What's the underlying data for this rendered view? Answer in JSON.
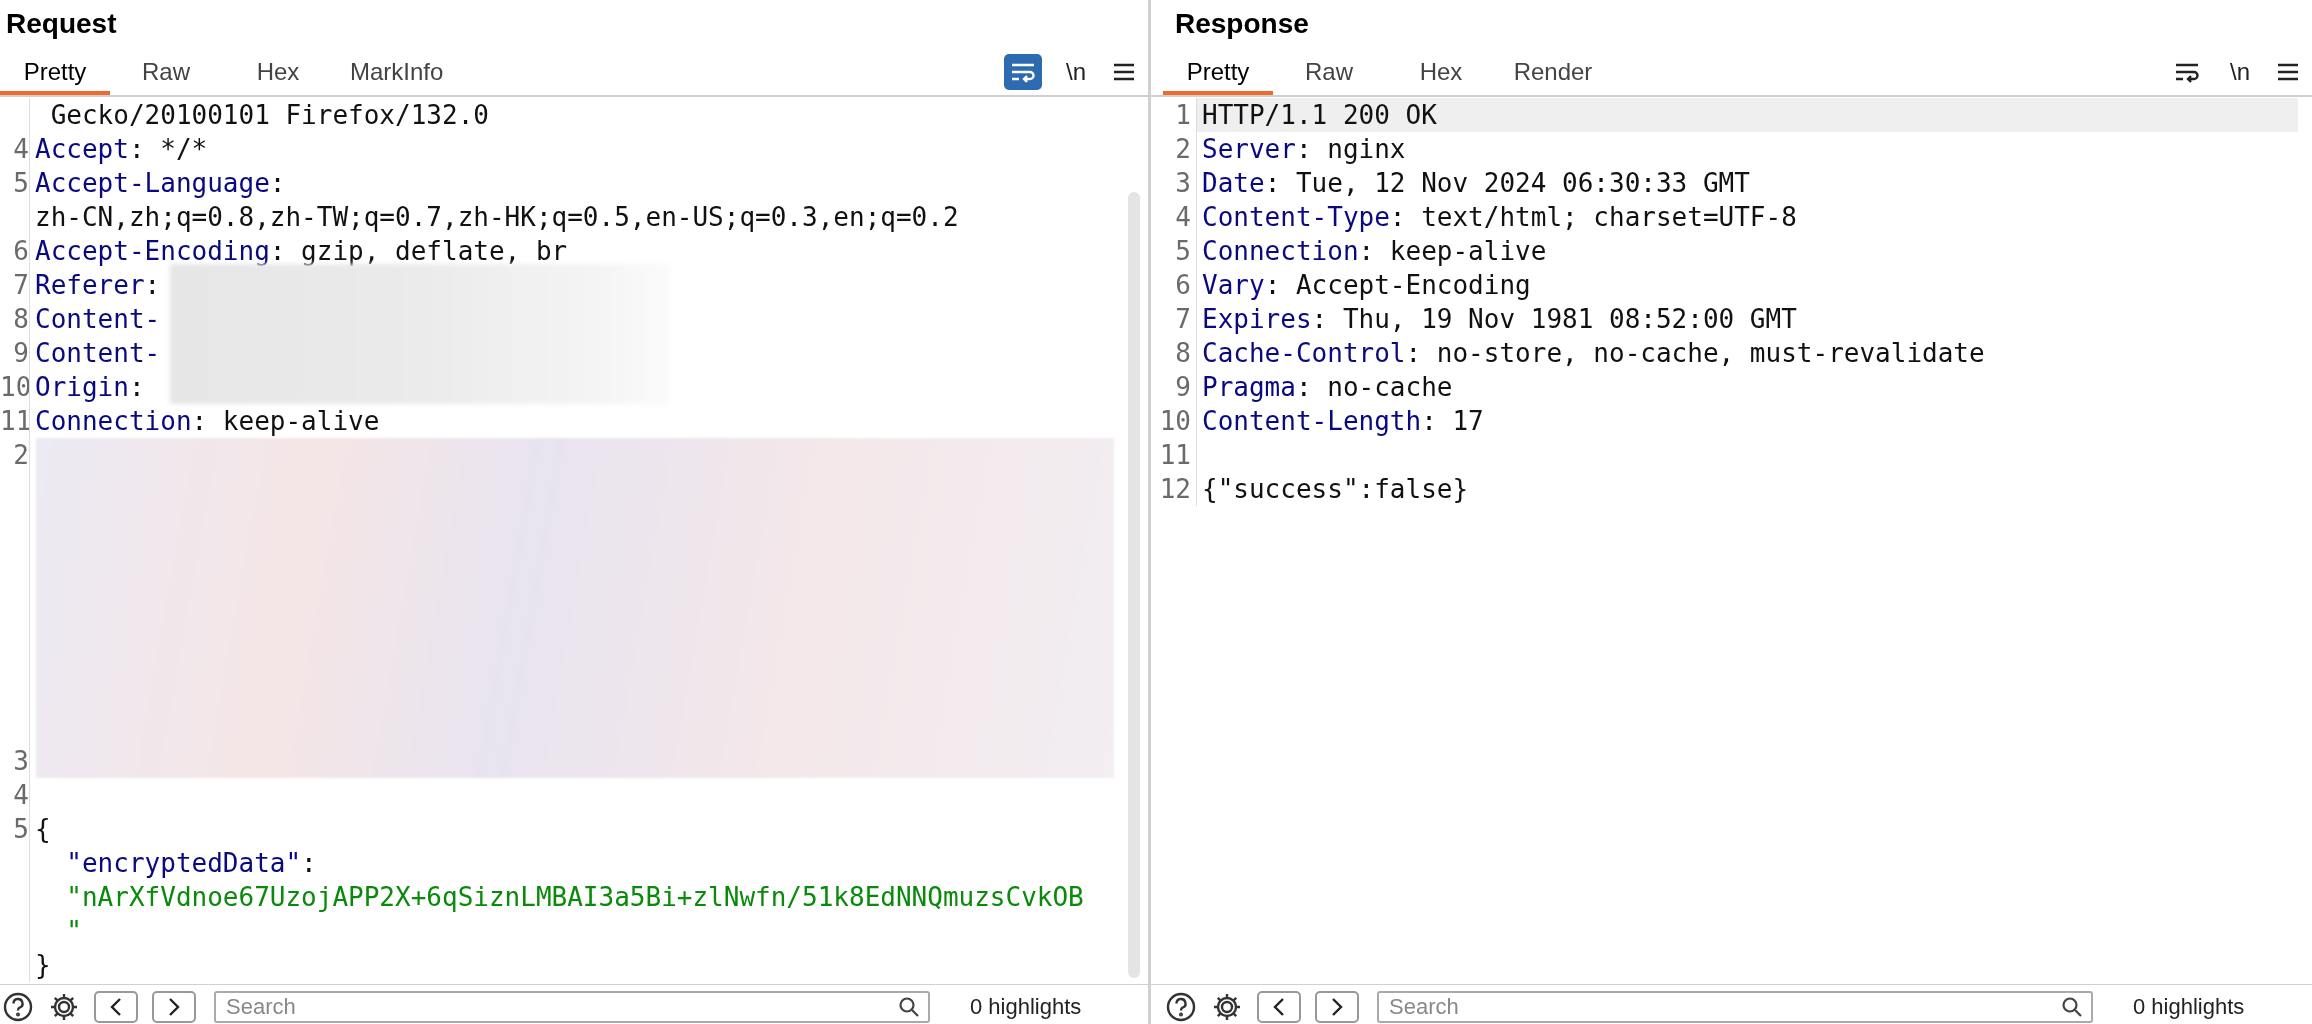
{
  "request": {
    "title": "Request",
    "tabs": [
      {
        "label": "Pretty",
        "selected": true
      },
      {
        "label": "Raw",
        "selected": false
      },
      {
        "label": "Hex",
        "selected": false
      },
      {
        "label": "MarkInfo",
        "selected": false
      }
    ],
    "toolbar": {
      "wrap_on": true,
      "newline_label": "\\n"
    },
    "lines": [
      {
        "kind": "code",
        "parts": [
          {
            "kind": "plain",
            "text": " Gecko/20100101 Firefox/132.0"
          }
        ]
      },
      {
        "kind": "code",
        "number": "4",
        "parts": [
          {
            "kind": "name",
            "text": "Accept"
          },
          {
            "kind": "plain",
            "text": ": */*"
          }
        ]
      },
      {
        "kind": "code",
        "number": "5",
        "parts": [
          {
            "kind": "name",
            "text": "Accept-Language"
          },
          {
            "kind": "plain",
            "text": ":"
          }
        ]
      },
      {
        "kind": "code",
        "parts": [
          {
            "kind": "plain",
            "text": "zh-CN,zh;q=0.8,zh-TW;q=0.7,zh-HK;q=0.5,en-US;q=0.3,en;q=0.2"
          }
        ]
      },
      {
        "kind": "code",
        "number": "6",
        "parts": [
          {
            "kind": "name",
            "text": "Accept-Encoding"
          },
          {
            "kind": "plain",
            "text": ": gzip, deflate, br"
          }
        ]
      },
      {
        "kind": "code",
        "number": "7",
        "redacted_values": true,
        "parts": [
          {
            "kind": "name",
            "text": "Referer"
          },
          {
            "kind": "plain",
            "text": ":"
          }
        ]
      },
      {
        "kind": "code",
        "number": "8",
        "parts": [
          {
            "kind": "name",
            "text": "Content-"
          }
        ]
      },
      {
        "kind": "code",
        "number": "9",
        "parts": [
          {
            "kind": "name",
            "text": "Content-"
          }
        ]
      },
      {
        "kind": "code",
        "number": "10",
        "parts": [
          {
            "kind": "name",
            "text": "Origin"
          },
          {
            "kind": "plain",
            "text": ":"
          }
        ]
      },
      {
        "kind": "code",
        "number": "11",
        "parts": [
          {
            "kind": "name",
            "text": "Connection"
          },
          {
            "kind": "plain",
            "text": ": keep-alive"
          }
        ]
      },
      {
        "kind": "redacted",
        "number": "2",
        "end_number": "3"
      },
      {
        "kind": "code",
        "number": "4"
      },
      {
        "kind": "code",
        "number": "5",
        "parts": [
          {
            "kind": "plain",
            "text": "{"
          }
        ]
      },
      {
        "kind": "code",
        "parts": [
          {
            "kind": "key",
            "text": "  \"encryptedData\""
          },
          {
            "kind": "plain",
            "text": ":"
          }
        ]
      },
      {
        "kind": "code",
        "parts": [
          {
            "kind": "string",
            "text": "  \"nArXfVdnoe67UzojAPP2X+6qSiznLMBAI3a5Bi+zlNwfn/51k8EdNNQmuzsCvkOB"
          }
        ]
      },
      {
        "kind": "code",
        "parts": [
          {
            "kind": "string",
            "text": "  \""
          }
        ]
      },
      {
        "kind": "code",
        "parts": [
          {
            "kind": "plain",
            "text": "}"
          }
        ]
      }
    ],
    "bottom_bar": {
      "search_placeholder": "Search",
      "highlights": "0 highlights"
    }
  },
  "response": {
    "title": "Response",
    "tabs": [
      {
        "label": "Pretty",
        "selected": true
      },
      {
        "label": "Raw",
        "selected": false
      },
      {
        "label": "Hex",
        "selected": false
      },
      {
        "label": "Render",
        "selected": false
      }
    ],
    "toolbar": {
      "wrap_on": false,
      "newline_label": "\\n"
    },
    "lines": [
      {
        "kind": "code",
        "number": "1",
        "highlighted": true,
        "parts": [
          {
            "kind": "plain",
            "text": "HTTP/1.1 200 OK"
          }
        ]
      },
      {
        "kind": "code",
        "number": "2",
        "highlighted": false,
        "parts": [
          {
            "kind": "name",
            "text": "Server"
          },
          {
            "kind": "plain",
            "text": ": nginx"
          }
        ]
      },
      {
        "kind": "code",
        "number": "3",
        "highlighted": false,
        "parts": [
          {
            "kind": "name",
            "text": "Date"
          },
          {
            "kind": "plain",
            "text": ": Tue, 12 Nov 2024 06:30:33 GMT"
          }
        ]
      },
      {
        "kind": "code",
        "number": "4",
        "highlighted": false,
        "parts": [
          {
            "kind": "name",
            "text": "Content-Type"
          },
          {
            "kind": "plain",
            "text": ": text/html; charset=UTF-8"
          }
        ]
      },
      {
        "kind": "code",
        "number": "5",
        "highlighted": false,
        "parts": [
          {
            "kind": "name",
            "text": "Connection"
          },
          {
            "kind": "plain",
            "text": ": keep-alive"
          }
        ]
      },
      {
        "kind": "code",
        "number": "6",
        "highlighted": false,
        "parts": [
          {
            "kind": "name",
            "text": "Vary"
          },
          {
            "kind": "plain",
            "text": ": Accept-Encoding"
          }
        ]
      },
      {
        "kind": "code",
        "number": "7",
        "highlighted": false,
        "parts": [
          {
            "kind": "name",
            "text": "Expires"
          },
          {
            "kind": "plain",
            "text": ": Thu, 19 Nov 1981 08:52:00 GMT"
          }
        ]
      },
      {
        "kind": "code",
        "number": "8",
        "highlighted": false,
        "parts": [
          {
            "kind": "name",
            "text": "Cache-Control"
          },
          {
            "kind": "plain",
            "text": ": no-store, no-cache, must-revalidate"
          }
        ]
      },
      {
        "kind": "code",
        "number": "9",
        "highlighted": false,
        "parts": [
          {
            "kind": "name",
            "text": "Pragma"
          },
          {
            "kind": "plain",
            "text": ": no-cache"
          }
        ]
      },
      {
        "kind": "code",
        "number": "10",
        "highlighted": false,
        "parts": [
          {
            "kind": "name",
            "text": "Content-Length"
          },
          {
            "kind": "plain",
            "text": ": 17"
          }
        ]
      },
      {
        "kind": "code",
        "number": "11",
        "highlighted": false
      },
      {
        "kind": "code",
        "number": "12",
        "highlighted": false,
        "parts": [
          {
            "kind": "plain",
            "text": "{\"success\":false}"
          }
        ]
      }
    ],
    "bottom_bar": {
      "search_placeholder": "Search",
      "highlights": "0 highlights"
    }
  }
}
